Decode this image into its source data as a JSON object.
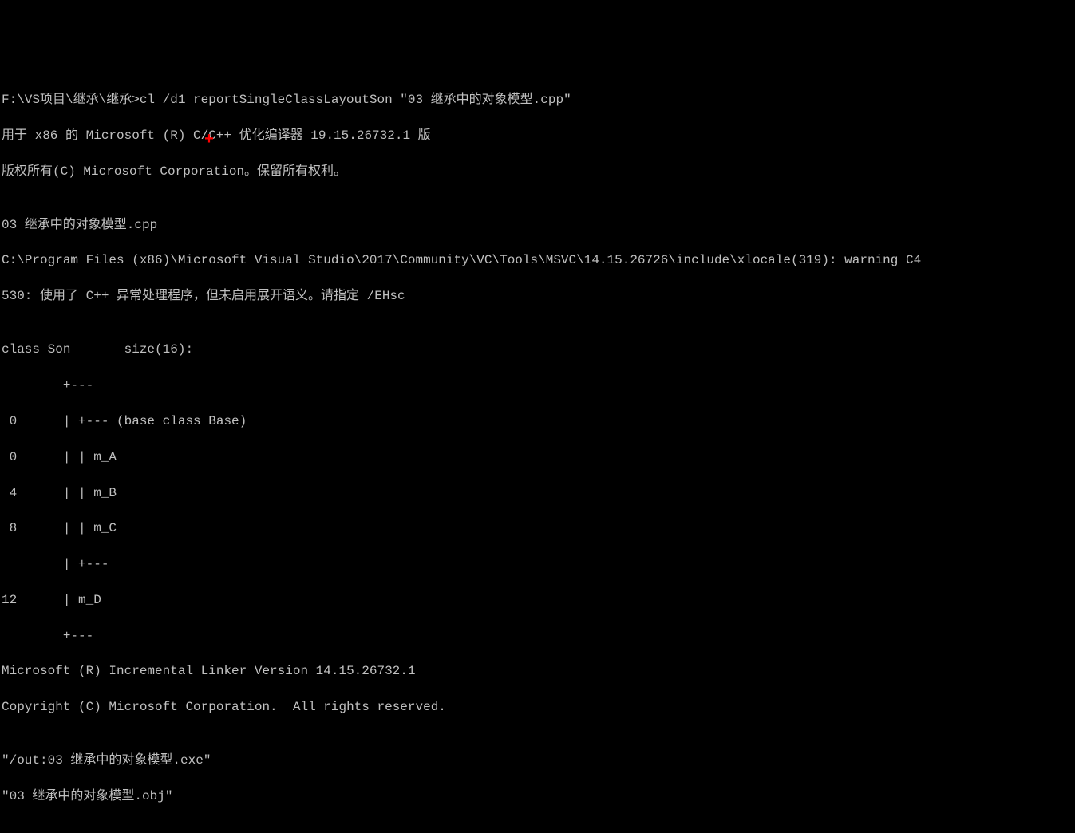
{
  "terminal": {
    "lines": [
      "F:\\VS项目\\继承\\继承>cl /d1 reportSingleClassLayoutSon \"03 继承中的对象模型.cpp\"",
      "用于 x86 的 Microsoft (R) C/C++ 优化编译器 19.15.26732.1 版",
      "版权所有(C) Microsoft Corporation。保留所有权利。",
      "",
      "03 继承中的对象模型.cpp",
      "C:\\Program Files (x86)\\Microsoft Visual Studio\\2017\\Community\\VC\\Tools\\MSVC\\14.15.26726\\include\\xlocale(319): warning C4",
      "530: 使用了 C++ 异常处理程序，但未启用展开语义。请指定 /EHsc",
      "",
      "class Son       size(16):",
      "        +---",
      " 0      | +--- (base class Base)",
      " 0      | | m_A",
      " 4      | | m_B",
      " 8      | | m_C",
      "        | +---",
      "12      | m_D",
      "        +---",
      "Microsoft (R) Incremental Linker Version 14.15.26732.1",
      "Copyright (C) Microsoft Corporation.  All rights reserved.",
      "",
      "\"/out:03 继承中的对象模型.exe\"",
      "\"03 继承中的对象模型.obj\""
    ]
  },
  "cursor": {
    "symbol": "+"
  }
}
